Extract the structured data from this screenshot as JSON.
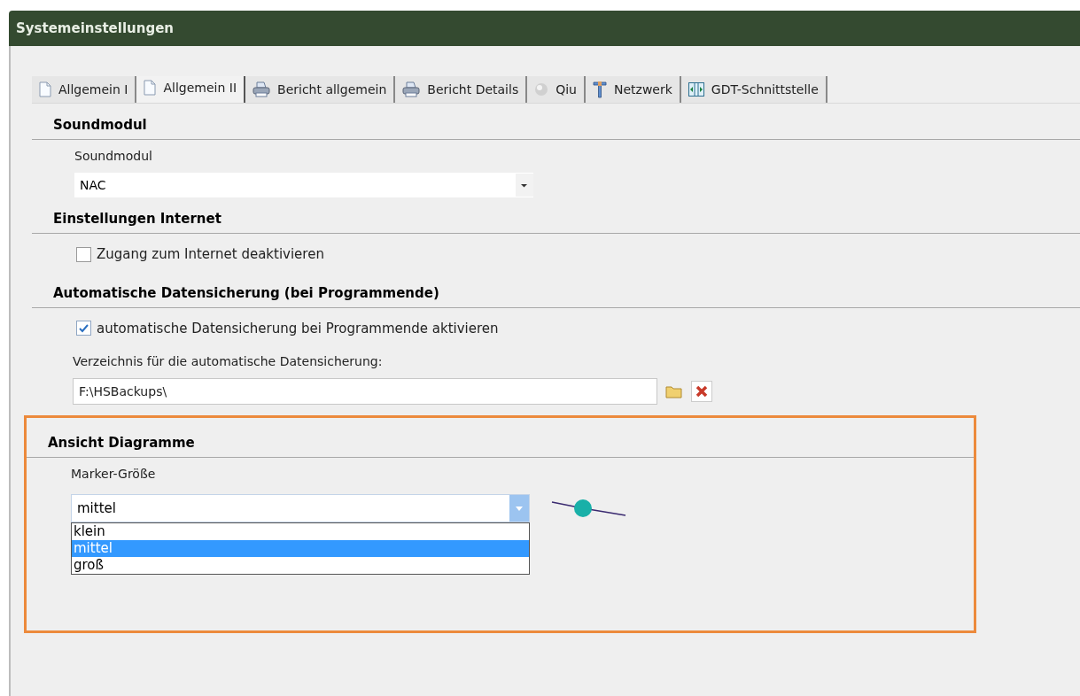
{
  "window": {
    "title": "Systemeinstellungen"
  },
  "tabs": [
    {
      "label": "Allgemein I",
      "kind": "page",
      "selected": false
    },
    {
      "label": "Allgemein II",
      "kind": "page",
      "selected": true
    },
    {
      "label": "Bericht allgemein",
      "kind": "printer",
      "selected": false
    },
    {
      "label": "Bericht Details",
      "kind": "printer",
      "selected": false
    },
    {
      "label": "Qiu",
      "kind": "ball",
      "selected": false
    },
    {
      "label": "Netzwerk",
      "kind": "tower",
      "selected": false
    },
    {
      "label": "GDT-Schnittstelle",
      "kind": "columns",
      "selected": false
    }
  ],
  "sound": {
    "heading": "Soundmodul",
    "label": "Soundmodul",
    "value": "NAC"
  },
  "internet": {
    "heading": "Einstellungen Internet",
    "checkbox": {
      "label": "Zugang zum Internet deaktivieren",
      "checked": false
    }
  },
  "backup": {
    "heading": "Automatische Datensicherung (bei Programmende)",
    "checkbox": {
      "label": "automatische Datensicherung bei Programmende aktivieren",
      "checked": true
    },
    "dir_label": "Verzeichnis für die automatische Datensicherung:",
    "dir_value": "F:\\HSBackups\\"
  },
  "charts": {
    "heading": "Ansicht Diagramme",
    "label": "Marker-Größe",
    "value": "mittel",
    "expanded": true,
    "options": [
      {
        "label": "klein",
        "selected": false
      },
      {
        "label": "mittel",
        "selected": true
      },
      {
        "label": "groß",
        "selected": false
      }
    ]
  }
}
